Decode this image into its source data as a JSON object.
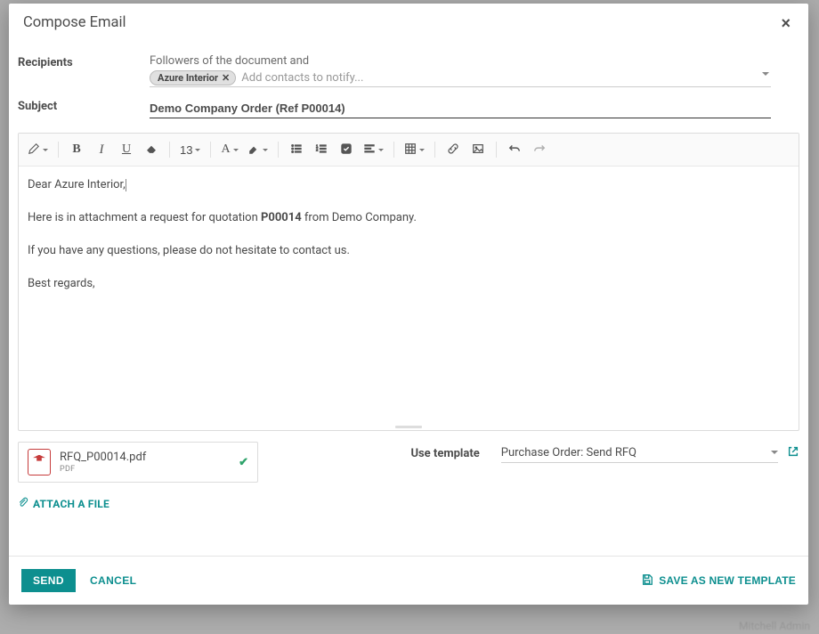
{
  "modal": {
    "title": "Compose Email",
    "close_aria": "Close"
  },
  "recipients": {
    "label": "Recipients",
    "followers_text": "Followers of the document and",
    "tags": [
      {
        "label": "Azure Interior"
      }
    ],
    "placeholder": "Add contacts to notify..."
  },
  "subject": {
    "label": "Subject",
    "value": "Demo Company Order (Ref P00014)"
  },
  "editor": {
    "font_size": "13",
    "body": {
      "greeting": "Dear Azure Interior,",
      "line1_pre": "Here is in attachment a request for quotation ",
      "line1_bold": "P00014",
      "line1_post": " from Demo Company.",
      "line2": "If you have any questions, please do not hesitate to contact us.",
      "signoff": "Best regards,"
    }
  },
  "attachment": {
    "file_name": "RFQ_P00014.pdf",
    "file_type": "PDF",
    "attach_label": "ATTACH A FILE"
  },
  "template": {
    "label": "Use template",
    "selected": "Purchase Order: Send RFQ"
  },
  "footer": {
    "send": "SEND",
    "cancel": "CANCEL",
    "save_template": "SAVE AS NEW TEMPLATE"
  },
  "background": {
    "snippet": "Mitchell Admin"
  }
}
